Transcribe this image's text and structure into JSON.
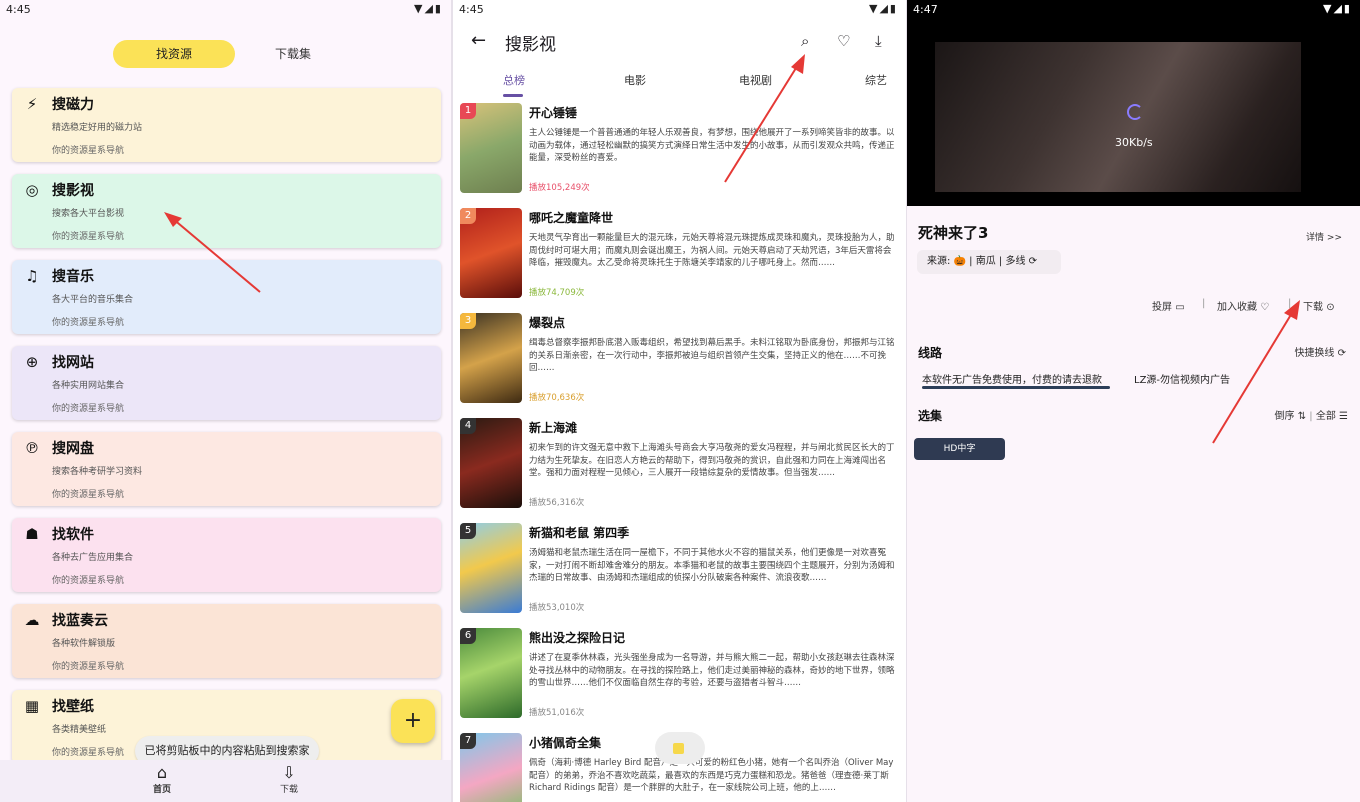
{
  "panel1": {
    "status": {
      "time": "4:45",
      "icons": "▼◢▮"
    },
    "top_tabs": {
      "active": "找资源",
      "other": "下载集"
    },
    "cards": [
      {
        "icon": "lightning-icon",
        "glyph": "⚡",
        "title": "搜磁力",
        "desc": "精选稳定好用的磁力站",
        "sub": "你的资源星系导航",
        "color": "#fdf3d8"
      },
      {
        "icon": "target-icon",
        "glyph": "◎",
        "title": "搜影视",
        "desc": "搜索各大平台影视",
        "sub": "你的资源星系导航",
        "color": "#dcf7e8"
      },
      {
        "icon": "music-icon",
        "glyph": "♫",
        "title": "搜音乐",
        "desc": "各大平台的音乐集合",
        "sub": "你的资源星系导航",
        "color": "#e2ecfb"
      },
      {
        "icon": "globe-icon",
        "glyph": "⊕",
        "title": "找网站",
        "desc": "各种实用网站集合",
        "sub": "你的资源星系导航",
        "color": "#ece6f8"
      },
      {
        "icon": "pinterest-icon",
        "glyph": "℗",
        "title": "搜网盘",
        "desc": "搜索各种考研学习资料",
        "sub": "你的资源星系导航",
        "color": "#fde8e2"
      },
      {
        "icon": "android-icon",
        "glyph": "☗",
        "title": "找软件",
        "desc": "各种去广告应用集合",
        "sub": "你的资源星系导航",
        "color": "#fce1ef"
      },
      {
        "icon": "cloud-icon",
        "glyph": "☁",
        "title": "找蓝奏云",
        "desc": "各种软件解锁版",
        "sub": "你的资源星系导航",
        "color": "#fbe4d6"
      },
      {
        "icon": "wallpaper-icon",
        "glyph": "▦",
        "title": "找壁纸",
        "desc": "各类精美壁纸",
        "sub": "你的资源星系导航",
        "color": "#fdf3d8"
      }
    ],
    "fab": "+",
    "toast": "已将剪贴板中的内容粘贴到搜索家",
    "nav": [
      {
        "icon": "⌂",
        "label": "首页"
      },
      {
        "icon": "⇩",
        "label": "下载"
      }
    ]
  },
  "panel2": {
    "status": {
      "time": "4:45",
      "icons": "▼◢▮"
    },
    "title": "搜影视",
    "tabs": [
      "总榜",
      "电影",
      "电视剧",
      "综艺"
    ],
    "movies": [
      {
        "rank": "1",
        "rank_color": "#e84855",
        "title": "开心锤锤",
        "desc": "主人公锤锤是一个普普通通的年轻人乐观善良，有梦想，围绕他展开了一系列啼笑皆非的故事。以动画为载体，通过轻松幽默的搞笑方式演绎日常生活中发生的小故事，从而引发观众共鸣，传递正能量，深受粉丝的喜爱。",
        "play": "播放105,249次",
        "play_color": "#e8506a",
        "poster": "linear-gradient(160deg,#d8c27a,#8aa86a 50%,#6e7f4f)"
      },
      {
        "rank": "2",
        "rank_color": "#f08a5d",
        "title": "哪吒之魔童降世",
        "desc": "天地灵气孕育出一颗能量巨大的混元珠，元始天尊将混元珠提炼成灵珠和魔丸，灵珠投胎为人，助周伐纣时可堪大用；而魔丸则会诞出魔王，为祸人间。元始天尊启动了天劫咒语，3年后天雷将会降临，摧毁魔丸。太乙受命将灵珠托生于陈塘关李靖家的儿子哪吒身上。然而……",
        "play": "播放74,709次",
        "play_color": "#8bb83c",
        "poster": "linear-gradient(160deg,#b0201b,#e0532a 50%,#5a0d0a)"
      },
      {
        "rank": "3",
        "rank_color": "#f5b83d",
        "title": "爆裂点",
        "desc": "缉毒总督察李振邦卧底潜入贩毒组织，希望找到幕后黑手。未料江铭取为卧底身份，邦振邦与江铭的关系日渐亲密，在一次行动中，李振邦被迫与组织首领产生交集，坚持正义的他在……不可挽回……",
        "play": "播放70,636次",
        "play_color": "#d9a030",
        "poster": "linear-gradient(160deg,#3b3223,#d4a24a 50%,#3e2a12)"
      },
      {
        "rank": "4",
        "rank_color": "#333333",
        "title": "新上海滩",
        "desc": "初来乍到的许文强无意中救下上海滩头号商会大亨冯敬尧的爱女冯程程，并与闸北贫民区长大的丁力结为生死挚友。在旧恋人方艳云的帮助下，得到冯敬尧的赏识，自此强和力同在上海滩闯出名堂。强和力面对程程一见倾心，三人展开一段错综复杂的爱情故事。但当强发……",
        "play": "播放56,316次",
        "play_color": "#888888",
        "poster": "linear-gradient(160deg,#2a1a12,#8a2a1f 50%,#1a0f0a)"
      },
      {
        "rank": "5",
        "rank_color": "#333333",
        "title": "新猫和老鼠 第四季",
        "desc": "汤姆猫和老鼠杰瑞生活在同一屋檐下，不同于其他水火不容的猫鼠关系，他们更像是一对欢喜冤家，一对打闹不断却难舍难分的朋友。本季猫和老鼠的故事主要围绕四个主题展开，分别为汤姆和杰瑞的日常故事、由汤姆和杰瑞组成的侦探小分队破案各种案件、流浪夜歌……",
        "play": "播放53,010次",
        "play_color": "#888888",
        "poster": "linear-gradient(160deg,#8fcde8,#f2c94c 45%,#3a7bd5)"
      },
      {
        "rank": "6",
        "rank_color": "#333333",
        "title": "熊出没之探险日记",
        "desc": "讲述了在夏季休林森，光头强坐身成为一名导游，并与熊大熊二一起，帮助小女孩赵琳去往森林深处寻找丛林中的动物朋友。在寻找的探险路上，他们走过美丽神秘的森林，奇妙的地下世界，领略的雪山世界……他们不仅面临自然生存的考验，还要与盗猎者斗智斗……",
        "play": "播放51,016次",
        "play_color": "#888888",
        "poster": "linear-gradient(160deg,#4a8a3c,#a6d46a 45%,#2d6a2a)"
      },
      {
        "rank": "7",
        "rank_color": "#333333",
        "title": "小猪佩奇全集",
        "desc": "佩奇（海莉·博德 Harley Bird 配音）是一只可爱的粉红色小猪，她有一个名叫乔治（Oliver May 配音）的弟弟，乔治不喜欢吃蔬菜，最喜欢的东西是巧克力蛋糕和恐龙。猪爸爸（理查德·莱丁斯 Richard Ridings 配音）是一个胖胖的大肚子，在一家线院公司上班，他的上……",
        "play": "",
        "play_color": "#888888",
        "poster": "linear-gradient(160deg,#7fc7ea,#f4a7c3 50%,#6bc15a)"
      }
    ]
  },
  "panel3": {
    "status": {
      "time": "4:47",
      "icons": "▼◢▮"
    },
    "speed": "30Kb/s",
    "title": "死神来了3",
    "detail": "详情 >>",
    "source": "来源: 🎃 | 南瓜 | 多线 ⟳",
    "actions": [
      {
        "label": "投屏",
        "icon": "cast-icon",
        "glyph": "▭"
      },
      {
        "label": "加入收藏",
        "icon": "heart-icon",
        "glyph": "♡"
      },
      {
        "label": "下载",
        "icon": "download-icon",
        "glyph": "⊙"
      }
    ],
    "lines_title": "线路",
    "quick_switch": "快捷换线 ⟳",
    "line1": "本软件无广告免费使用，付费的请去退款",
    "line2": "LZ源-勿信视频内广告",
    "episodes_title": "选集",
    "sort": "倒序 ⇅",
    "all": "全部 ☰",
    "ep_btn": "HD中字"
  }
}
